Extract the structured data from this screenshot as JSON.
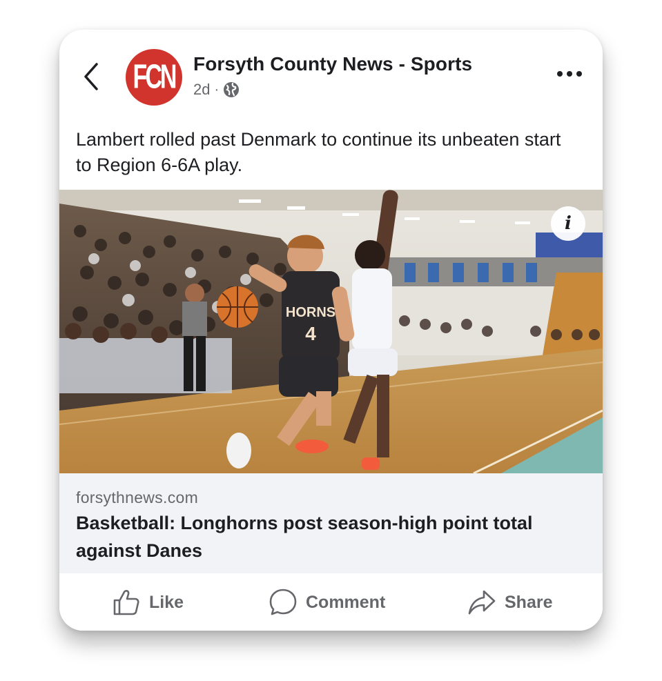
{
  "post": {
    "page_name": "Forsyth County News - Sports",
    "logo_text": "FCN",
    "time_ago": "2d",
    "separator": "·",
    "audience_icon": "globe-icon",
    "caption": "Lambert rolled past Denmark to continue its unbeaten start to Region 6-6A play."
  },
  "photo": {
    "info_label": "i",
    "jersey_team": "HORNS",
    "jersey_number": "4"
  },
  "link": {
    "domain": "forsythnews.com",
    "title": "Basketball: Longhorns post season-high point total against Danes"
  },
  "actions": {
    "like_label": "Like",
    "comment_label": "Comment",
    "share_label": "Share"
  },
  "colors": {
    "brand_red": "#d0342c",
    "text_primary": "#1c1e21",
    "text_secondary": "#65676b",
    "preview_bg": "#f2f3f7"
  }
}
